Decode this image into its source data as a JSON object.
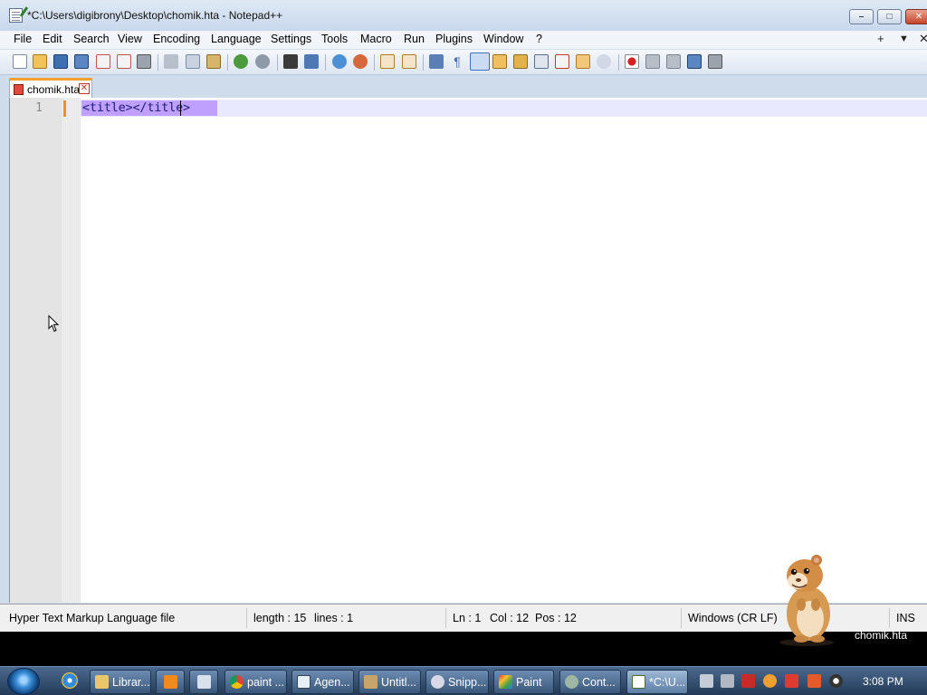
{
  "window": {
    "title": "*C:\\Users\\digibrony\\Desktop\\chomik.hta - Notepad++",
    "controls": {
      "minimize": "–",
      "maximize": "□",
      "close": "✕"
    }
  },
  "menu": {
    "items": [
      "File",
      "Edit",
      "Search",
      "View",
      "Encoding",
      "Language",
      "Settings",
      "Tools",
      "Macro",
      "Run",
      "Plugins",
      "Window",
      "?"
    ],
    "right": {
      "add": "+",
      "dropdown": "▼",
      "close": "✕"
    }
  },
  "toolbar": {
    "icons": [
      "new-file-icon",
      "open-file-icon",
      "save-icon",
      "save-all-icon",
      "close-icon",
      "close-all-icon",
      "print-icon",
      "cut-icon",
      "copy-icon",
      "paste-icon",
      "undo-icon",
      "redo-icon",
      "find-icon",
      "replace-icon",
      "zoom-in-icon",
      "zoom-out-icon",
      "sync-vertical-icon",
      "sync-horizontal-icon",
      "word-wrap-icon",
      "show-all-characters-icon",
      "indent-guide-icon",
      "user-language-icon",
      "doc-map-icon",
      "function-list-icon",
      "folder-workspace-icon",
      "monitoring-icon",
      "record-macro-icon",
      "stop-record-icon",
      "playback-macro-icon",
      "run-macro-multiple-icon",
      "save-macro-icon"
    ]
  },
  "tab": {
    "label": "chomik.hta",
    "close": "✕"
  },
  "editor": {
    "line_number": "1",
    "code": "<title></title>"
  },
  "status": {
    "file_type": "Hyper Text Markup Language file",
    "length": "length : 15",
    "lines": "lines : 1",
    "ln": "Ln : 1",
    "col": "Col : 12",
    "pos": "Pos : 12",
    "eol": "Windows (CR LF)",
    "mode": "INS"
  },
  "desktop": {
    "gadget_label": "chomik.hta"
  },
  "taskbar": {
    "buttons": [
      {
        "label": "Librar...",
        "icon": "explorer-icon",
        "active": false
      },
      {
        "label": "",
        "icon": "media-player-icon",
        "active": false
      },
      {
        "label": "",
        "icon": "calculator-icon",
        "active": false
      },
      {
        "label": "paint ...",
        "icon": "chrome-icon",
        "active": false
      },
      {
        "label": "Agen...",
        "icon": "window-icon",
        "active": false
      },
      {
        "label": "Untitl...",
        "icon": "app-icon",
        "active": false
      },
      {
        "label": "Snipp...",
        "icon": "snipping-tool-icon",
        "active": false
      },
      {
        "label": "Paint",
        "icon": "paint-icon",
        "active": false
      },
      {
        "label": "Cont...",
        "icon": "app-icon",
        "active": false
      },
      {
        "label": "*C:\\U...",
        "icon": "notepad-plus-plus-icon",
        "active": true
      }
    ],
    "clock": "3:08 PM"
  },
  "colors": {
    "selection": "#c0a0ff",
    "current_line": "#e8e8ff",
    "tab_accent": "#f2a12f",
    "change_marker": "#f28c28"
  }
}
